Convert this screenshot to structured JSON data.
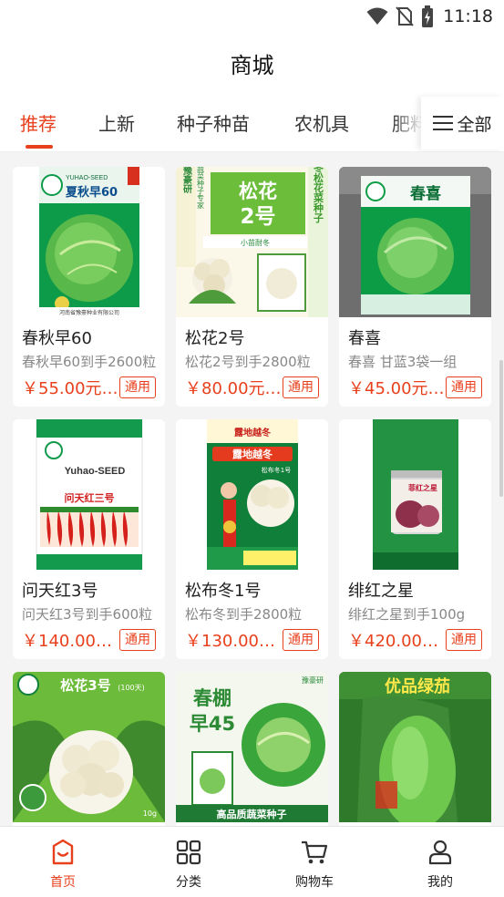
{
  "status_bar": {
    "time": "11:18",
    "icons": [
      "wifi-icon",
      "no-sim-icon",
      "battery-charging-icon"
    ]
  },
  "header": {
    "title": "商城"
  },
  "tabs": [
    {
      "label": "推荐",
      "active": true
    },
    {
      "label": "上新",
      "active": false
    },
    {
      "label": "种子种苗",
      "active": false
    },
    {
      "label": "农机具",
      "active": false
    },
    {
      "label": "肥料",
      "active": false
    }
  ],
  "all_button": {
    "label": "全部",
    "icon": "menu-icon"
  },
  "products": [
    {
      "name": "春秋早60",
      "desc": "春秋早60到手2600粒",
      "price": "￥55.00元/袋",
      "tag": "通用",
      "image": "cabbage-seed-package",
      "image_text": {
        "brand": "YUHAO-SEED",
        "title": "夏秋早60",
        "footer": "河南省豫豪种业有限公司"
      }
    },
    {
      "name": "松花2号",
      "desc": "松花2号到手2800粒",
      "price": "￥80.00元/袋",
      "tag": "通用",
      "image": "cauliflower-seed-package",
      "image_text": {
        "side_left": "豫豪研",
        "side_left_sub": "您的蔬菜种子专家",
        "title": "松花",
        "title2": "2号",
        "subtitle": "小苗耐冬",
        "side_right": "露地越冬松花菜种子"
      }
    },
    {
      "name": "春喜",
      "desc": "春喜 甘蓝3袋一组",
      "price": "￥45.00元/袋",
      "tag": "通用",
      "image": "cabbage-seed-package",
      "image_text": {
        "title": "春喜"
      }
    },
    {
      "name": "问天红3号",
      "desc": "问天红3号到手600粒",
      "price": "￥140.00元/袋",
      "tag": "通用",
      "image": "pepper-seed-package",
      "image_text": {
        "brand": "Yuhao-SEED",
        "title": "问天红三号"
      }
    },
    {
      "name": "松布冬1号",
      "desc": "松布冬到手2800粒",
      "price": "￥130.00元/袋",
      "tag": "通用",
      "image": "cauliflower-seed-package",
      "image_text": {
        "top": "露地越冬",
        "title": "露地越冬",
        "subtitle": "松布冬1号"
      }
    },
    {
      "name": "绯红之星",
      "desc": "绯红之星到手100g",
      "price": "￥420.00元/罐",
      "tag": "通用",
      "image": "onion-seed-can",
      "image_text": {
        "label": "菲红之星"
      }
    },
    {
      "name": "",
      "desc": "",
      "price": "",
      "tag": "",
      "image": "cauliflower-photo",
      "image_text": {
        "title": "松花3号",
        "sub": "(100天)",
        "weight": "10g"
      }
    },
    {
      "name": "",
      "desc": "",
      "price": "",
      "tag": "",
      "image": "cabbage-photo",
      "image_text": {
        "title": "春棚",
        "title2": "早45",
        "corner": "豫豪研",
        "banner": "高品质蔬菜种子"
      }
    },
    {
      "name": "",
      "desc": "",
      "price": "",
      "tag": "",
      "image": "eggplant-photo",
      "image_text": {
        "title": "优品绿茄"
      }
    }
  ],
  "bottom_nav": [
    {
      "label": "首页",
      "icon": "home-icon",
      "active": true
    },
    {
      "label": "分类",
      "icon": "category-grid-icon",
      "active": false
    },
    {
      "label": "购物车",
      "icon": "cart-icon",
      "active": false
    },
    {
      "label": "我的",
      "icon": "user-icon",
      "active": false
    }
  ],
  "colors": {
    "accent": "#e8401c",
    "page_background": "#f4f4f4"
  }
}
